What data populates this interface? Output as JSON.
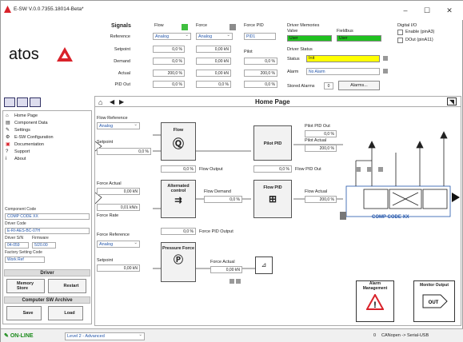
{
  "window": {
    "title": "E-SW V.0.0.7355.18014-Beta*",
    "minimize": "–",
    "maximize": "☐",
    "close": "✕"
  },
  "logo": "atos",
  "signals": {
    "title": "Signals",
    "flow": "Flow",
    "force": "Force",
    "forcepid": "Force PID",
    "forcepid_value": "PID1",
    "reference": "Reference",
    "setpoint": "Setpoint",
    "demand": "Demand",
    "actual": "Actual",
    "pidout": "PID Out",
    "pilot": "Pilot",
    "flow_ref": "Analog",
    "force_ref": "Analog",
    "flow_setpoint": "0,0 %",
    "flow_demand": "0,0 %",
    "flow_actual": "200,0 %",
    "flow_pidout": "0,0 %",
    "force_setpoint": "0,00 kN",
    "force_demand": "0,00 kN",
    "force_actual": "0,00 kN",
    "force_pidout": "0,0 %",
    "pilot_demand": "0,0 %",
    "pilot_actual": "200,0 %",
    "pilot_pidout": "0,0 %"
  },
  "drivermem": {
    "title": "Driver Memories",
    "valve": "Valve",
    "fieldbus": "Fieldbus",
    "valve_val": "User",
    "fieldbus_val": "User",
    "status_title": "Driver Status",
    "status": "Status",
    "status_val": "Init",
    "alarm": "Alarm",
    "alarm_val": "No Alarm",
    "stored": "Stored Alarms",
    "stored_val": "0",
    "alarms_btn": "Alarms..."
  },
  "digital": {
    "title": "Digital I/O",
    "enable": "Enable (pinA3)",
    "dout": "DOut (pinA11)"
  },
  "toolbar": {
    "home_title": "Home Page"
  },
  "nav": [
    {
      "icon": "⌂",
      "label": "Home Page"
    },
    {
      "icon": "▤",
      "label": "Component Data"
    },
    {
      "icon": "✎",
      "label": "Settings"
    },
    {
      "icon": "⚙",
      "label": "E-SW Configuration"
    },
    {
      "icon": "▣",
      "label": "Documentation"
    },
    {
      "icon": "?",
      "label": "Support"
    },
    {
      "icon": "i",
      "label": "About"
    }
  ],
  "component": {
    "code_lbl": "Component Code",
    "code": "COMP CODE   XX",
    "driver_lbl": "Driver Code",
    "driver": "E-RI-AES-BC-07H",
    "sn_lbl": "Driver S/N",
    "sn": "04-059",
    "fw_lbl": "Firmware",
    "fw": "5/20.00",
    "factory_lbl": "Factory Setting Code",
    "factory": "Work Ref",
    "driver_hdr": "Driver",
    "memstore": "Memory Store",
    "restart": "Restart",
    "archive_hdr": "Computer SW Archive",
    "save": "Save",
    "load": "Load"
  },
  "diagram": {
    "flow_ref_lbl": "Flow Reference",
    "flow_ref": "Analog",
    "setpoint_lbl": "Setpoint",
    "setpoint": "0,0 %",
    "flow_block": "Flow",
    "pilot_pid_out_lbl": "Pilot PID Out",
    "pilot_pid_out": "0,0 %",
    "pilot_actual_lbl": "Pilot Actual",
    "pilot_actual": "200,0 %",
    "pilot_pid": "Pilot PID",
    "flow_output": "Flow Output",
    "flow_output_val": "0,0 %",
    "flow_pid_out": "Flow PID Out",
    "flow_pid_out_val": "0,0 %",
    "force_actual_lbl": "Force Actual",
    "force_actual": "0,00 kN",
    "force_rate_lbl": "Force Rate",
    "force_rate": "0,01 kN/s",
    "alt_control": "Alternated control",
    "flow_demand_lbl": "Flow Demand",
    "flow_demand": "0,0 %",
    "flow_pid": "Flow PID",
    "flow_actual_lbl": "Flow Actual",
    "flow_actual": "200,0 %",
    "force_pid_output": "Force PID Output",
    "force_pid_output_val": "0,0 %",
    "force_ref_lbl": "Force Reference",
    "force_ref": "Analog",
    "setpoint2_lbl": "Setpoint",
    "setpoint2": "0,00 kN",
    "pressure_force": "Pressure Force",
    "force_actual2_lbl": "Force Actual",
    "force_actual2": "0,00 kN",
    "comp_code": "COMP CODE     XX",
    "alarm_mgmt": "Alarm Management",
    "monitor_output": "Monitor Output",
    "out": "OUT"
  },
  "statusbar": {
    "online": "ON-LINE",
    "level": "Level 2 - Advanced",
    "conn": "CANopen -> Serial-USB",
    "conn_num": "0"
  }
}
